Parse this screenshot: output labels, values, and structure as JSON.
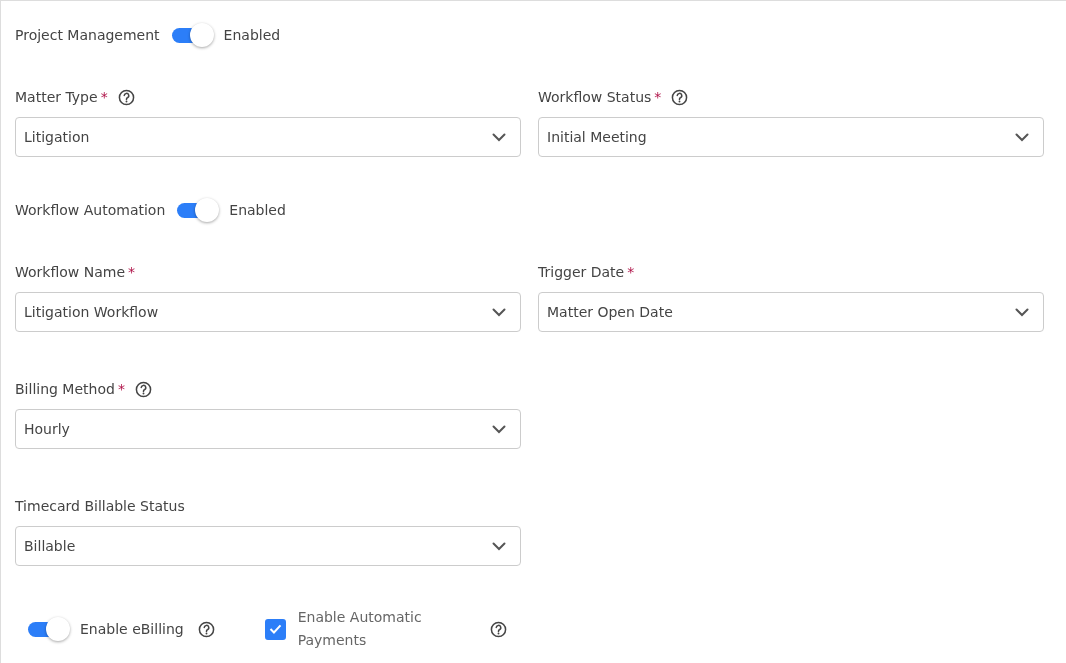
{
  "sections": [
    {
      "kind": "toggle",
      "label": "Project Management",
      "on": true,
      "state_text": "Enabled"
    },
    {
      "kind": "fields",
      "fields": [
        {
          "label": "Matter Type",
          "required_mark": "*",
          "help": true,
          "value": "Litigation"
        },
        {
          "label": "Workflow Status",
          "required_mark": "*",
          "help": true,
          "value": "Initial Meeting"
        }
      ]
    },
    {
      "kind": "toggle",
      "label": "Workflow Automation",
      "on": true,
      "state_text": "Enabled"
    },
    {
      "kind": "fields",
      "fields": [
        {
          "label": "Workflow Name",
          "required_mark": "*",
          "help": false,
          "value": "Litigation Workflow"
        },
        {
          "label": "Trigger Date",
          "required_mark": "*",
          "help": false,
          "value": "Matter Open Date"
        }
      ]
    },
    {
      "kind": "fields",
      "fields": [
        {
          "label": "Billing Method",
          "required_mark": "*",
          "help": true,
          "value": "Hourly"
        }
      ]
    },
    {
      "kind": "fields",
      "fields": [
        {
          "label": "Timecard Billable Status",
          "help": false,
          "value": "Billable"
        }
      ]
    },
    {
      "kind": "options",
      "items": [
        {
          "kind": "switch",
          "label": "Enable eBilling",
          "on": true,
          "help": true
        },
        {
          "kind": "checkbox",
          "label": "Enable Automatic Payments",
          "checked": true,
          "help": true
        }
      ]
    }
  ]
}
